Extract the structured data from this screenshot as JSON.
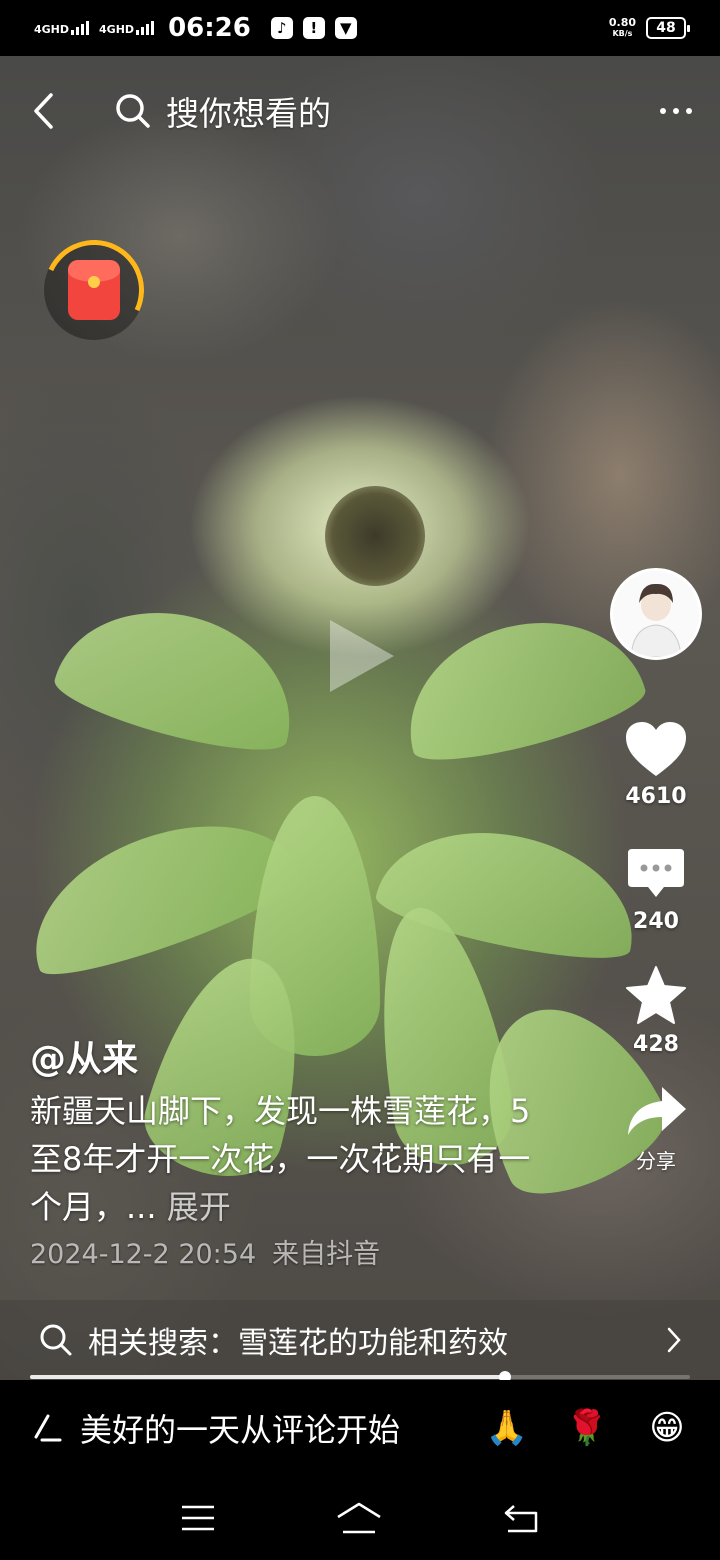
{
  "status_bar": {
    "signal1": "4GHD",
    "signal2": "4GHD",
    "time": "06:26",
    "net_speed_value": "0.80",
    "net_speed_unit": "KB/s",
    "battery": "48"
  },
  "top_bar": {
    "search_placeholder": "搜你想看的"
  },
  "video": {
    "author": "@从来",
    "description": "新疆天山脚下，发现一株雪莲花，5至8年才开一次花，一次花期只有一个月，...",
    "expand_label": "展开",
    "date": "2024-12-2 20:54",
    "source": "来自抖音",
    "progress": 0.72
  },
  "actions": {
    "likes": "4610",
    "comments": "240",
    "favorites": "428",
    "share": "分享"
  },
  "related_search": {
    "label": "相关搜索：雪莲花的功能和药效"
  },
  "comment_bar": {
    "placeholder": "美好的一天从评论开始",
    "emojis": [
      "🙏",
      "🌹",
      "😁"
    ]
  },
  "colors": {
    "redpacket": "#f2453d",
    "ring": "#ffb81c"
  }
}
